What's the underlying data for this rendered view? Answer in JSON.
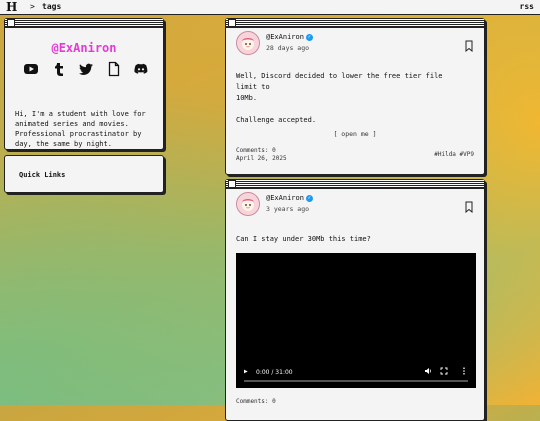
{
  "topbar": {
    "logo": "H",
    "separator": ">",
    "breadcrumb": "tags",
    "rss": "rss"
  },
  "profile": {
    "name": "@ExAniron",
    "socials": [
      "youtube-icon",
      "tumblr-icon",
      "twitter-icon",
      "file-icon",
      "discord-icon"
    ],
    "bio": "Hi, I'm a student with love for\nanimated series and movies.\nProfessional procrastinator by\nday, the same by night."
  },
  "quick_links": {
    "title": "Quick Links"
  },
  "posts": [
    {
      "handle": "@ExAniron",
      "age": "28 days ago",
      "text": "Well, Discord decided to lower the free tier file limit to\n10Mb.\n\nChallenge accepted.",
      "open_me": "[ open me ]",
      "comments": "Comments: 0",
      "date": "April 26, 2025",
      "tags": "#Hilda #VP9"
    },
    {
      "handle": "@ExAniron",
      "age": "3 years ago",
      "text": "Can I stay under 30Mb this time?",
      "video_time": "0:00 / 31:00",
      "comments": "Comments: 0"
    }
  ],
  "colors": {
    "accent": "#e53ad6",
    "verified": "#1d9bf0"
  }
}
